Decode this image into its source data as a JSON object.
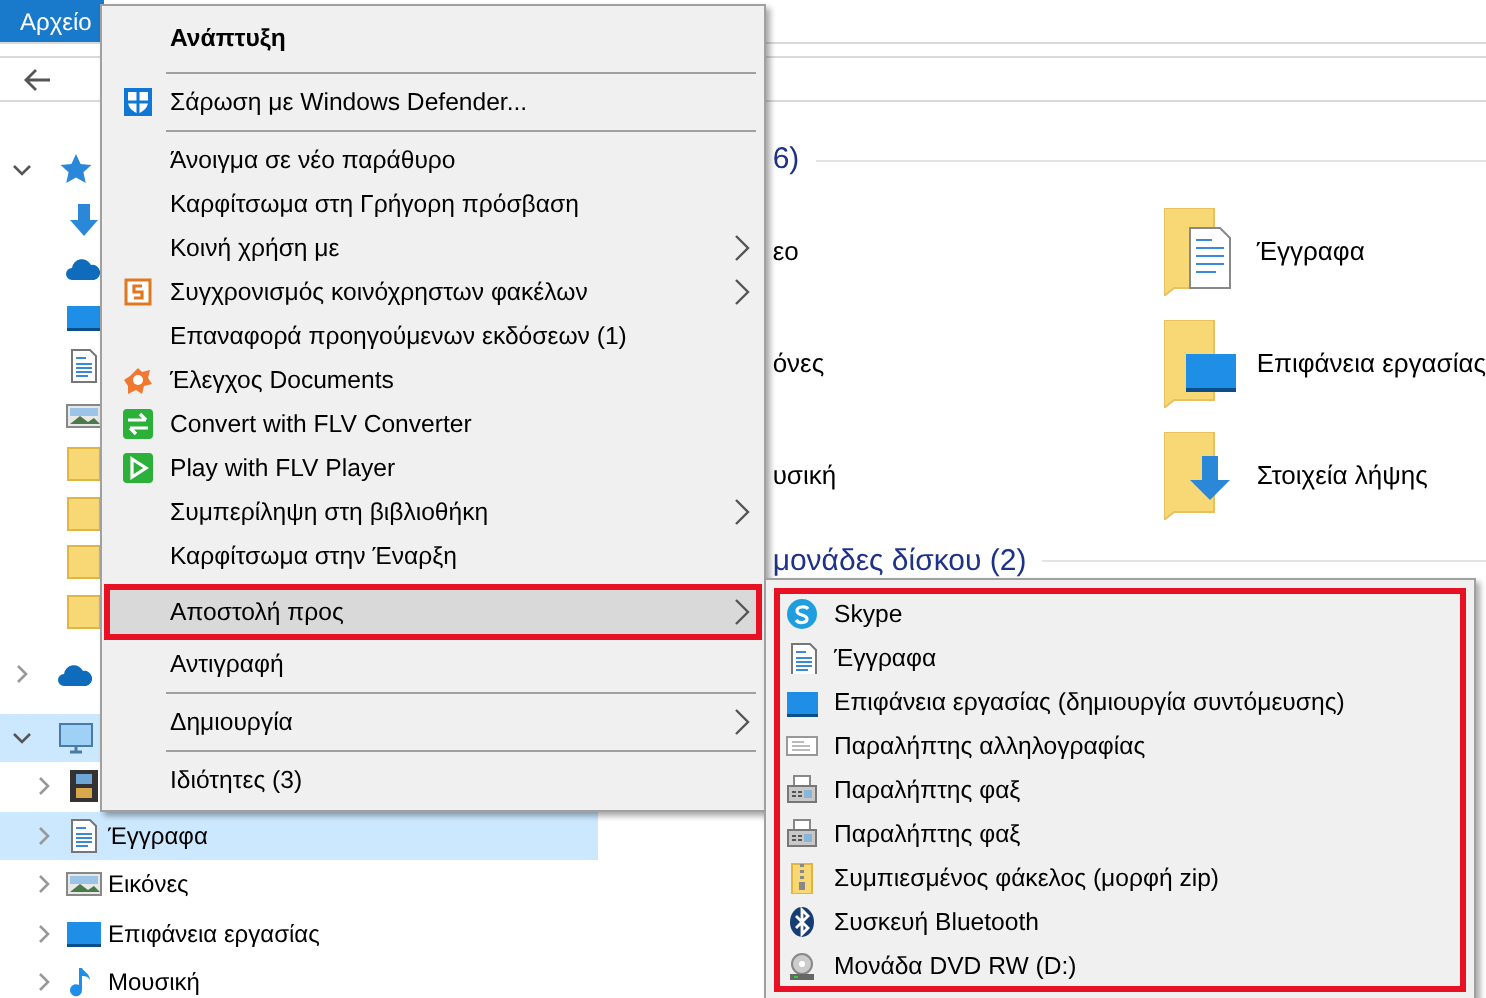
{
  "ribbon": {
    "file_tab": "Αρχείο"
  },
  "tree": [
    {
      "kind": "star",
      "expanded": true,
      "selected": false,
      "children": [
        {
          "kind": "download"
        },
        {
          "kind": "cloud"
        },
        {
          "kind": "desktop"
        },
        {
          "kind": "doc"
        },
        {
          "kind": "pictures"
        },
        {
          "kind": "folder"
        },
        {
          "kind": "folder"
        },
        {
          "kind": "folder"
        },
        {
          "kind": "folder"
        }
      ]
    },
    {
      "kind": "cloud",
      "expanded": false,
      "selected": false
    },
    {
      "kind": "pc",
      "expanded": true,
      "selected": true,
      "children": [
        {
          "kind": "video",
          "expanded": false,
          "selected": false
        },
        {
          "label": "Έγγραφα",
          "kind": "doc",
          "expanded": false,
          "selected": true
        },
        {
          "label": "Εικόνες",
          "kind": "pictures",
          "expanded": false,
          "selected": false
        },
        {
          "label": "Επιφάνεια εργασίας",
          "kind": "desktop",
          "expanded": false,
          "selected": false
        },
        {
          "label": "Μουσική",
          "kind": "music",
          "expanded": false,
          "selected": false
        }
      ]
    }
  ],
  "content": {
    "sections": [
      {
        "title": "6)",
        "items": [
          {
            "label": "εο"
          },
          {
            "label": "Έγγραφα",
            "kind": "doc"
          },
          {
            "label": "όνες"
          },
          {
            "label": "Επιφάνεια εργασίας",
            "kind": "desktop"
          },
          {
            "label": "υσική"
          },
          {
            "label": "Στοιχεία λήψης",
            "kind": "download"
          }
        ]
      },
      {
        "title": "μονάδες δίσκου (2)"
      }
    ]
  },
  "context_menu": [
    {
      "kind": "header",
      "label": "Ανάπτυξη"
    },
    {
      "kind": "separator"
    },
    {
      "kind": "item",
      "label": "Σάρωση με Windows Defender...",
      "submenu": false,
      "selected": false
    },
    {
      "kind": "separator"
    },
    {
      "kind": "item",
      "label": "Άνοιγμα σε νέο παράθυρο",
      "submenu": false,
      "selected": false
    },
    {
      "kind": "item",
      "label": "Καρφίτσωμα στη Γρήγορη πρόσβαση",
      "submenu": false,
      "selected": false
    },
    {
      "kind": "item",
      "label": "Κοινή χρήση με",
      "submenu": true,
      "selected": false
    },
    {
      "kind": "item",
      "label": "Συγχρονισμός κοινόχρηστων φακέλων",
      "submenu": true,
      "selected": false
    },
    {
      "kind": "item",
      "label": "Επαναφορά προηγούμενων εκδόσεων (1)",
      "submenu": false,
      "selected": false
    },
    {
      "kind": "item",
      "label": "Έλεγχος Documents",
      "submenu": false,
      "selected": false
    },
    {
      "kind": "item",
      "label": "Convert with FLV Converter",
      "submenu": false,
      "selected": false
    },
    {
      "kind": "item",
      "label": "Play with FLV Player",
      "submenu": false,
      "selected": false
    },
    {
      "kind": "item",
      "label": "Συμπερίληψη στη βιβλιοθήκη",
      "submenu": true,
      "selected": false
    },
    {
      "kind": "item",
      "label": "Καρφίτσωμα στην Έναρξη",
      "submenu": false,
      "selected": false
    },
    {
      "kind": "item",
      "label": "Αποστολή προς",
      "submenu": true,
      "selected": true,
      "highlighted": true
    },
    {
      "kind": "item",
      "label": "Αντιγραφή",
      "submenu": false,
      "selected": false
    },
    {
      "kind": "separator"
    },
    {
      "kind": "item",
      "label": "Δημιουργία",
      "submenu": true,
      "selected": false
    },
    {
      "kind": "separator"
    },
    {
      "kind": "item",
      "label": "Ιδιότητες (3)",
      "submenu": false,
      "selected": false
    }
  ],
  "send_to_menu": {
    "highlighted": true,
    "items": [
      {
        "label": "Skype",
        "kind": "skype"
      },
      {
        "label": "Έγγραφα",
        "kind": "doc"
      },
      {
        "label": "Επιφάνεια εργασίας (δημιουργία συντόμευσης)",
        "kind": "desktop"
      },
      {
        "label": "Παραλήπτης αλληλογραφίας",
        "kind": "mail"
      },
      {
        "label": "Παραλήπτης φαξ",
        "kind": "fax"
      },
      {
        "label": "Παραλήπτης φαξ",
        "kind": "fax"
      },
      {
        "label": "Συμπιεσμένος φάκελος (μορφή zip)",
        "kind": "zip"
      },
      {
        "label": "Συσκευή Bluetooth",
        "kind": "bluetooth"
      },
      {
        "label": "Μονάδα DVD RW (D:)",
        "kind": "dvd"
      }
    ]
  }
}
